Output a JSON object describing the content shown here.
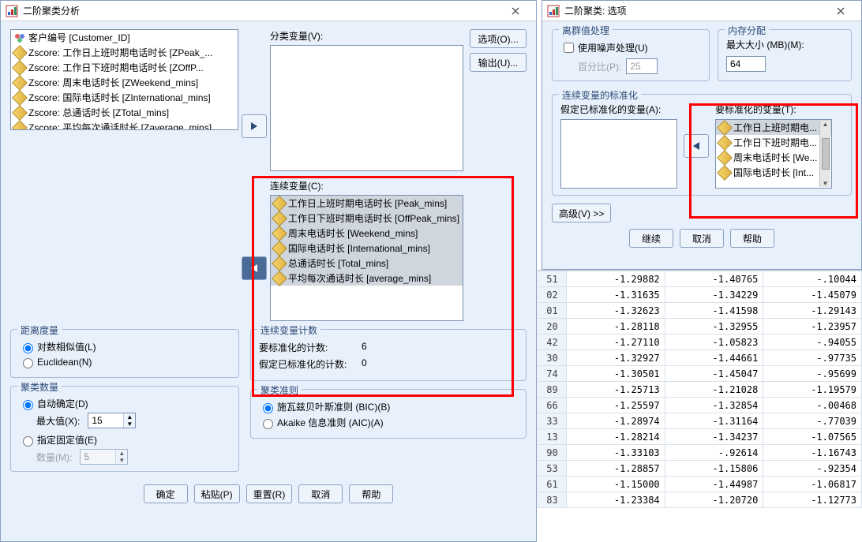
{
  "dlg1": {
    "title": "二阶聚类分析",
    "source_vars": [
      {
        "icon": "nominal",
        "label": "客户编号 [Customer_ID]"
      },
      {
        "icon": "scale",
        "label": "Zscore:  工作日上班时期电话时长 [ZPeak_..."
      },
      {
        "icon": "scale",
        "label": "Zscore:  工作日下班时期电话时长 [ZOffP..."
      },
      {
        "icon": "scale",
        "label": "Zscore:  周末电话时长 [ZWeekend_mins]"
      },
      {
        "icon": "scale",
        "label": "Zscore:  国际电话时长 [ZInternational_mins]"
      },
      {
        "icon": "scale",
        "label": "Zscore:  总通话时长 [ZTotal_mins]"
      },
      {
        "icon": "scale",
        "label": "Zscore:  平均每次通话时长 [Zaverage_mins]"
      }
    ],
    "cat_label": "分类变量(V):",
    "cont_label": "连续变量(C):",
    "cont_vars": [
      "工作日上班时期电话时长 [Peak_mins]",
      "工作日下班时期电话时长 [OffPeak_mins]",
      "周末电话时长 [Weekend_mins]",
      "国际电话时长 [International_mins]",
      "总通话时长 [Total_mins]",
      "平均每次通话时长 [average_mins]"
    ],
    "side_options": "选项(O)...",
    "side_output": "输出(U)...",
    "counts_legend": "连续变量计数",
    "count_tostd_label": "要标准化的计数:",
    "count_tostd_val": "6",
    "count_assumed_label": "假定已标准化的计数:",
    "count_assumed_val": "0",
    "distance_legend": "距离度量",
    "dist_loglik": "对数相似值(L)",
    "dist_euclid": "Euclidean(N)",
    "clusters_legend": "聚类数量",
    "clu_auto": "自动确定(D)",
    "clu_max_label": "最大值(X):",
    "clu_max_val": "15",
    "clu_fixed": "指定固定值(E)",
    "clu_num_label": "数量(M):",
    "clu_num_val": "5",
    "criteria_legend": "聚类准则",
    "crit_bic": "施瓦兹贝叶斯准则  (BIC)(B)",
    "crit_aic": "Akaike 信息准则  (AIC)(A)",
    "btn_ok": "确定",
    "btn_paste": "粘贴(P)",
    "btn_reset": "重置(R)",
    "btn_cancel": "取消",
    "btn_help": "帮助"
  },
  "dlg2": {
    "title": "二阶聚类: 选项",
    "outlier_legend": "离群值处理",
    "outlier_use": "使用噪声处理(U)",
    "outlier_pct_label": "百分比(P):",
    "outlier_pct_val": "25",
    "mem_legend": "内存分配",
    "mem_label": "最大大小 (MB)(M):",
    "mem_val": "64",
    "std_legend": "连续变量的标准化",
    "std_assumed_label": "假定已标准化的变量(A):",
    "std_to_label": "要标准化的变量(T):",
    "std_to_vars": [
      "工作日上班时期电...",
      "工作日下班时期电...",
      "周末电话时长 [We...",
      "国际电话时长 [Int..."
    ],
    "adv_btn": "高级(V) >>",
    "btn_continue": "继续",
    "btn_cancel": "取消",
    "btn_help": "帮助"
  },
  "grid_rows": [
    {
      "h": "51",
      "c": [
        "-1.29882",
        "-1.40765",
        "-.10044"
      ]
    },
    {
      "h": "02",
      "c": [
        "-1.31635",
        "-1.34229",
        "-1.45079"
      ]
    },
    {
      "h": "01",
      "c": [
        "-1.32623",
        "-1.41598",
        "-1.29143"
      ]
    },
    {
      "h": "20",
      "c": [
        "-1.28118",
        "-1.32955",
        "-1.23957"
      ]
    },
    {
      "h": "42",
      "c": [
        "-1.27110",
        "-1.05823",
        "-.94055"
      ]
    },
    {
      "h": "30",
      "c": [
        "-1.32927",
        "-1.44661",
        "-.97735"
      ]
    },
    {
      "h": "74",
      "c": [
        "-1.30501",
        "-1.45047",
        "-.95699"
      ]
    },
    {
      "h": "89",
      "c": [
        "-1.25713",
        "-1.21028",
        "-1.19579"
      ]
    },
    {
      "h": "66",
      "c": [
        "-1.25597",
        "-1.32854",
        "-.00468"
      ]
    },
    {
      "h": "33",
      "c": [
        "-1.28974",
        "-1.31164",
        "-.77039"
      ]
    },
    {
      "h": "13",
      "c": [
        "-1.28214",
        "-1.34237",
        "-1.07565"
      ]
    },
    {
      "h": "90",
      "c": [
        "-1.33103",
        "-.92614",
        "-1.16743"
      ]
    },
    {
      "h": "53",
      "c": [
        "-1.28857",
        "-1.15806",
        "-.92354"
      ]
    },
    {
      "h": "61",
      "c": [
        "-1.15000",
        "-1.44987",
        "-1.06817"
      ]
    },
    {
      "h": "83",
      "c": [
        "-1.23384",
        "-1.20720",
        "-1.12773"
      ]
    }
  ]
}
